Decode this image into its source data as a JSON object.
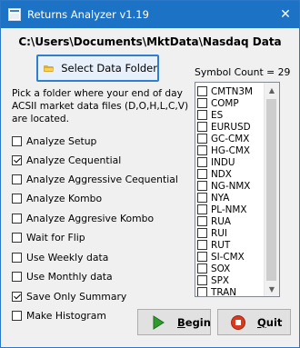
{
  "window": {
    "title": "Returns Analyzer v1.19",
    "close_glyph": "✕"
  },
  "path": "C:\\Users\\Documents\\MktData\\Nasdaq Data",
  "select_folder_button": "Select Data Folder",
  "description": "Pick a folder where your end of day ACSII market data files (D,O,H,L,C,V) are located.",
  "options": [
    {
      "label": "Analyze Setup",
      "checked": false
    },
    {
      "label": "Analyze Cequential",
      "checked": true
    },
    {
      "label": "Analyze Aggressive Cequential",
      "checked": false
    },
    {
      "label": "Analyze Kombo",
      "checked": false
    },
    {
      "label": "Analyze Aggresive Kombo",
      "checked": false
    },
    {
      "label": "Wait for Flip",
      "checked": false
    },
    {
      "label": "Use Weekly data",
      "checked": false
    },
    {
      "label": "Use Monthly data",
      "checked": false
    },
    {
      "label": "Save Only Summary",
      "checked": true
    },
    {
      "label": "Make Histogram",
      "checked": false
    }
  ],
  "symbol_count": "Symbol Count = 29",
  "symbols": [
    "CMTN3M",
    "COMP",
    "ES",
    "EURUSD",
    "GC-CMX",
    "HG-CMX",
    "INDU",
    "NDX",
    "NG-NMX",
    "NYA",
    "PL-NMX",
    "RUA",
    "RUI",
    "RUT",
    "SI-CMX",
    "SOX",
    "SPX",
    "TRAN"
  ],
  "buttons": {
    "begin": {
      "label": "Begin",
      "mnemonic": "B"
    },
    "quit": {
      "label": "Quit",
      "mnemonic": "Q"
    }
  },
  "icons": {
    "app": "app-window-icon",
    "folder": "folder-icon",
    "begin": "play-arrow-icon",
    "quit": "stop-icon"
  },
  "colors": {
    "titlebar": "#1c73c6",
    "select_border": "#2f7fd0",
    "play_green": "#2e9b2e",
    "quit_red": "#d83b1e"
  }
}
